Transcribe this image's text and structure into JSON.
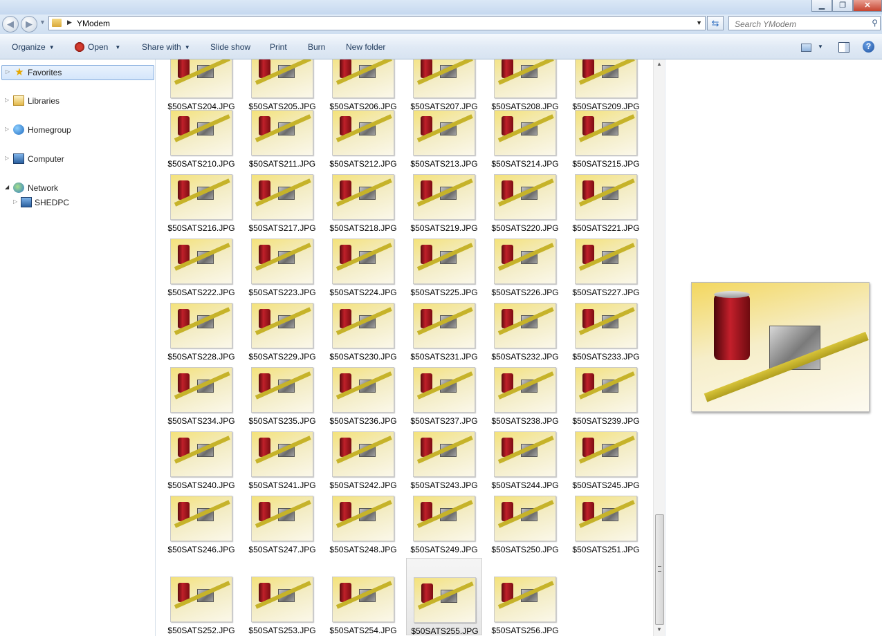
{
  "window": {
    "controls": {
      "minimize": "▁",
      "maximize": "❐",
      "close": "✕"
    }
  },
  "address": {
    "path": "YModem",
    "search_placeholder": "Search YModem"
  },
  "toolbar": {
    "organize": "Organize",
    "open": "Open",
    "share_with": "Share with",
    "slide_show": "Slide show",
    "print": "Print",
    "burn": "Burn",
    "new_folder": "New folder"
  },
  "nav": {
    "favorites": "Favorites",
    "libraries": "Libraries",
    "homegroup": "Homegroup",
    "computer": "Computer",
    "network": "Network",
    "shedpc": "SHEDPC"
  },
  "files": [
    "$50SATS204.JPG",
    "$50SATS205.JPG",
    "$50SATS206.JPG",
    "$50SATS207.JPG",
    "$50SATS208.JPG",
    "$50SATS209.JPG",
    "$50SATS210.JPG",
    "$50SATS211.JPG",
    "$50SATS212.JPG",
    "$50SATS213.JPG",
    "$50SATS214.JPG",
    "$50SATS215.JPG",
    "$50SATS216.JPG",
    "$50SATS217.JPG",
    "$50SATS218.JPG",
    "$50SATS219.JPG",
    "$50SATS220.JPG",
    "$50SATS221.JPG",
    "$50SATS222.JPG",
    "$50SATS223.JPG",
    "$50SATS224.JPG",
    "$50SATS225.JPG",
    "$50SATS226.JPG",
    "$50SATS227.JPG",
    "$50SATS228.JPG",
    "$50SATS229.JPG",
    "$50SATS230.JPG",
    "$50SATS231.JPG",
    "$50SATS232.JPG",
    "$50SATS233.JPG",
    "$50SATS234.JPG",
    "$50SATS235.JPG",
    "$50SATS236.JPG",
    "$50SATS237.JPG",
    "$50SATS238.JPG",
    "$50SATS239.JPG",
    "$50SATS240.JPG",
    "$50SATS241.JPG",
    "$50SATS242.JPG",
    "$50SATS243.JPG",
    "$50SATS244.JPG",
    "$50SATS245.JPG",
    "$50SATS246.JPG",
    "$50SATS247.JPG",
    "$50SATS248.JPG",
    "$50SATS249.JPG",
    "$50SATS250.JPG",
    "$50SATS251.JPG",
    "$50SATS252.JPG",
    "$50SATS253.JPG",
    "$50SATS254.JPG",
    "$50SATS255.JPG",
    "$50SATS256.JPG"
  ],
  "selected_file": "$50SATS255.JPG",
  "preview": {
    "image": "can-and-satellite-photo"
  }
}
